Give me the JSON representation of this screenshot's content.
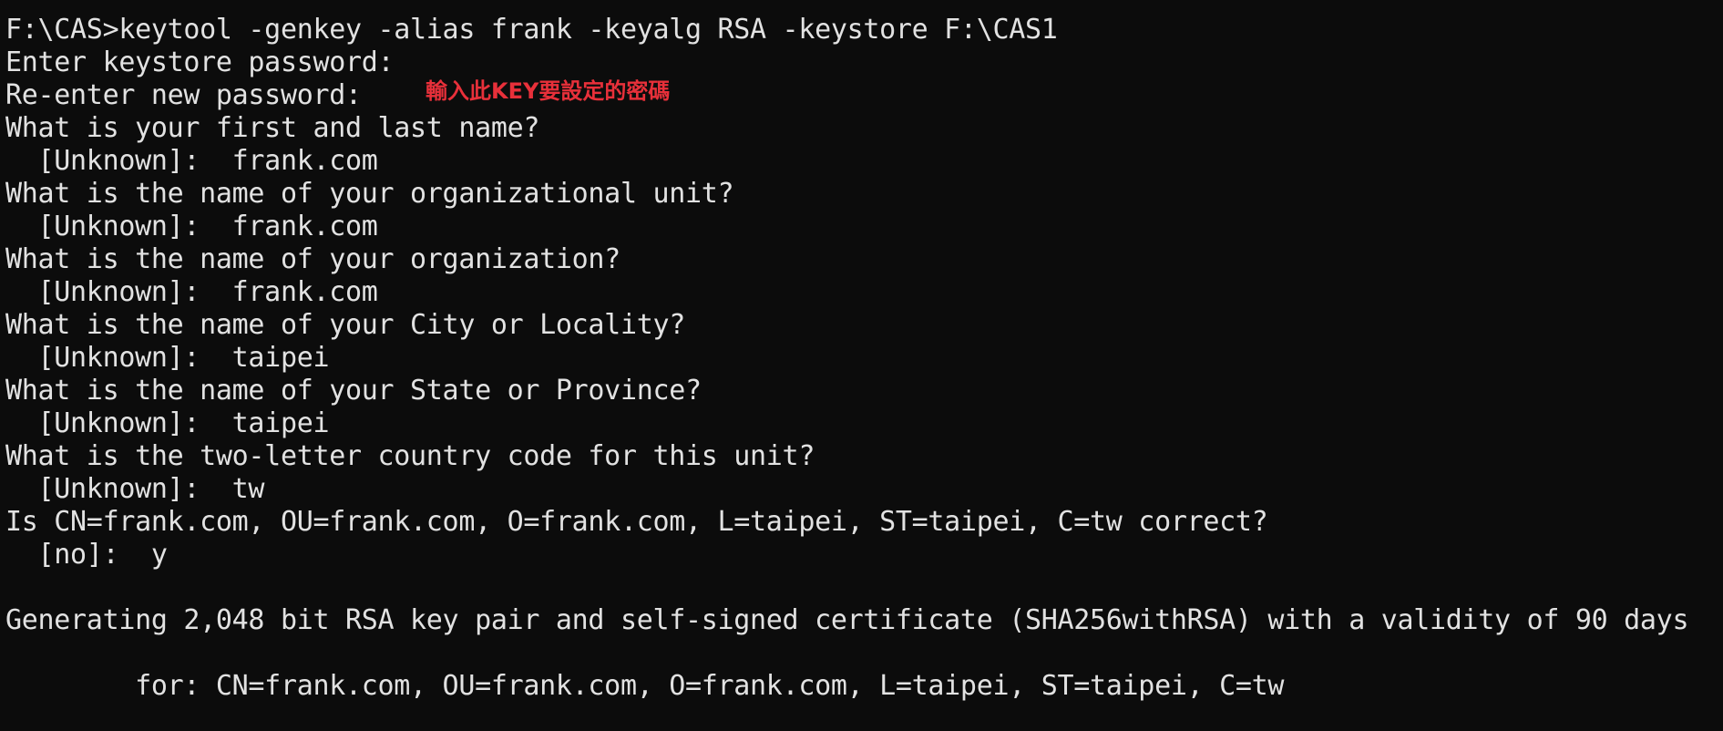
{
  "terminal": {
    "lines": [
      "F:\\CAS>keytool -genkey -alias frank -keyalg RSA -keystore F:\\CAS1",
      "Enter keystore password:",
      "Re-enter new password:",
      "What is your first and last name?",
      "  [Unknown]:  frank.com",
      "What is the name of your organizational unit?",
      "  [Unknown]:  frank.com",
      "What is the name of your organization?",
      "  [Unknown]:  frank.com",
      "What is the name of your City or Locality?",
      "  [Unknown]:  taipei",
      "What is the name of your State or Province?",
      "  [Unknown]:  taipei",
      "What is the two-letter country code for this unit?",
      "  [Unknown]:  tw",
      "Is CN=frank.com, OU=frank.com, O=frank.com, L=taipei, ST=taipei, C=tw correct?",
      "  [no]:  y",
      "",
      "Generating 2,048 bit RSA key pair and self-signed certificate (SHA256withRSA) with a validity of 90 days",
      "",
      "        for: CN=frank.com, OU=frank.com, O=frank.com, L=taipei, ST=taipei, C=tw"
    ],
    "annotation": "輸入此KEY要設定的密碼"
  },
  "colors": {
    "background": "#0c0c0c",
    "text": "#e2e2e2",
    "annotation": "#e8303a"
  }
}
